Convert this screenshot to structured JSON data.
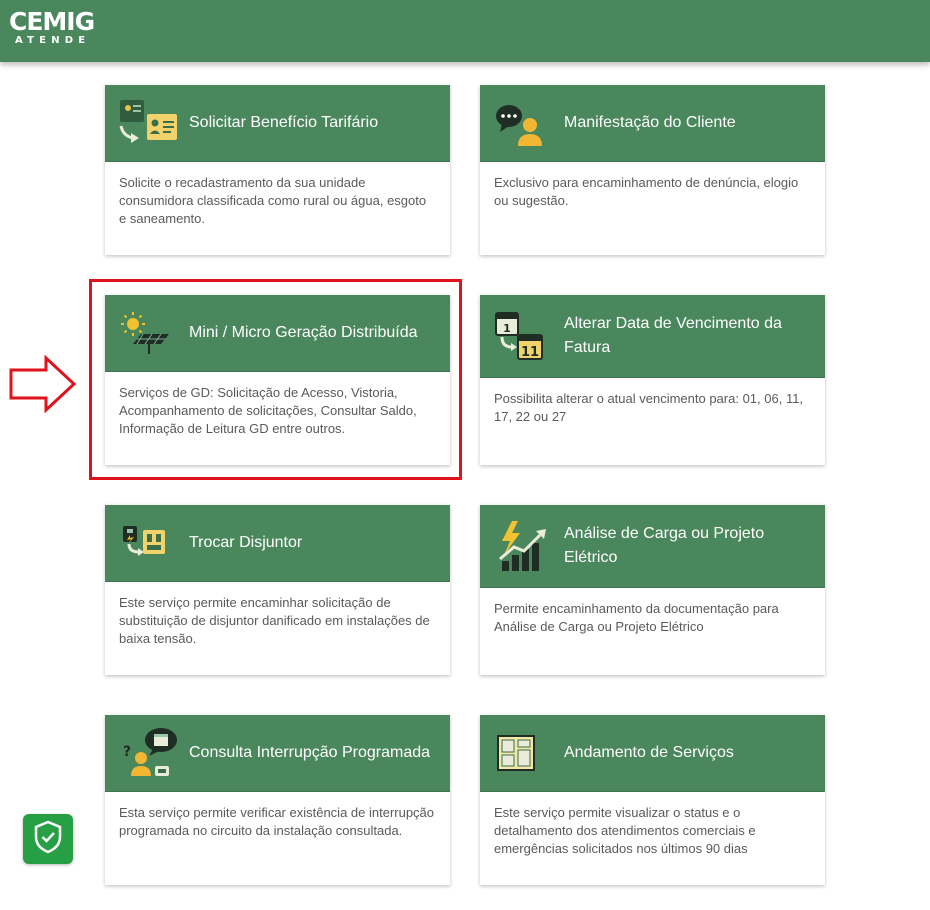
{
  "header": {
    "logo_text": "CEMIG",
    "logo_subtext": "ATENDE"
  },
  "colors": {
    "header_green": "#4a875d",
    "highlight_red": "#e0131d",
    "shield_green": "#27a045"
  },
  "cards": [
    {
      "icon": "beneficio-tarifario-icon",
      "title": "Solicitar Benefício Tarifário",
      "description": "Solicite o recadastramento da sua unidade consumidora classificada como rural ou água, esgoto e saneamento."
    },
    {
      "icon": "manifestacao-cliente-icon",
      "title": "Manifestação do Cliente",
      "description": "Exclusivo para encaminhamento de denúncia, elogio ou sugestão."
    },
    {
      "icon": "solar-panel-icon",
      "title": "Mini / Micro Geração Distribuída",
      "description": "Serviços de GD: Solicitação de Acesso, Vistoria, Acompanhamento de solicitações, Consultar Saldo, Informação de Leitura GD entre outros."
    },
    {
      "icon": "calendar-icon",
      "title": "Alterar Data de Vencimento da Fatura",
      "description": "Possibilita alterar o atual vencimento para: 01, 06, 11, 17, 22 ou 27"
    },
    {
      "icon": "breaker-swap-icon",
      "title": "Trocar Disjuntor",
      "description": "Este serviço permite encaminhar solicitação de substituição de disjuntor danificado em instalações de baixa tensão."
    },
    {
      "icon": "load-analysis-icon",
      "title": "Análise de Carga ou Projeto Elétrico",
      "description": "Permite encaminhamento da documentação para Análise de Carga ou Projeto Elétrico"
    },
    {
      "icon": "scheduled-outage-icon",
      "title": "Consulta Interrupção Programada",
      "description": "Esta serviço permite verificar existência de interrupção programada no circuito da instalação consultada."
    },
    {
      "icon": "service-progress-icon",
      "title": "Andamento de Serviços",
      "description": "Este serviço permite visualizar o status e o detalhamento dos atendimentos comerciais e emergências solicitados nos últimos 90 dias"
    }
  ],
  "annotations": {
    "highlighted_card": "Mini / Micro Geração Distribuída",
    "arrow_icon": "right-arrow-icon",
    "security_badge_icon": "shield-check-icon"
  }
}
